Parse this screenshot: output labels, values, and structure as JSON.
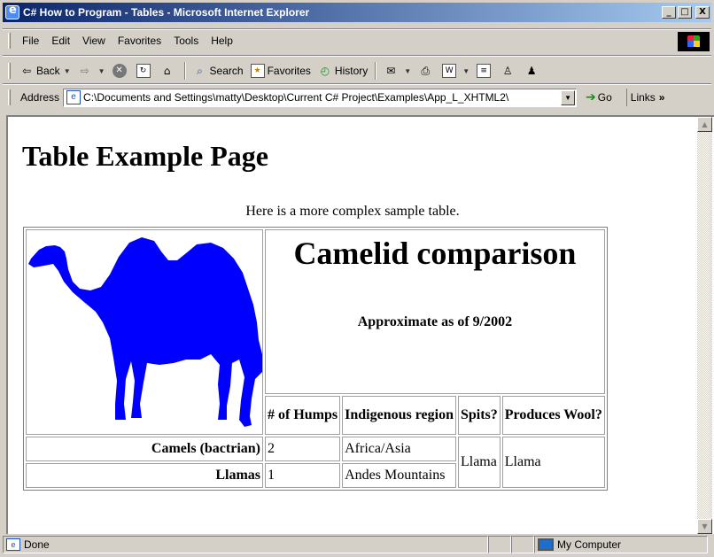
{
  "window": {
    "title": "C# How to Program - Tables - Microsoft Internet Explorer",
    "minimize": "_",
    "maximize": "□",
    "close": "X"
  },
  "menu": [
    "File",
    "Edit",
    "View",
    "Favorites",
    "Tools",
    "Help"
  ],
  "toolbar": {
    "back": "Back",
    "search": "Search",
    "favorites": "Favorites",
    "history": "History"
  },
  "address": {
    "label": "Address",
    "value": "C:\\Documents and Settings\\matty\\Desktop\\Current C# Project\\Examples\\App_L_XHTML2\\",
    "go": "Go",
    "links": "Links"
  },
  "page": {
    "heading": "Table Example Page",
    "caption": "Here is a more complex sample table.",
    "table": {
      "title": "Camelid comparison",
      "subtitle": "Approximate as of 9/2002",
      "headers": [
        "# of Humps",
        "Indigenous region",
        "Spits?",
        "Produces Wool?"
      ],
      "rows": [
        {
          "name": "Camels (bactrian)",
          "humps": "2",
          "region": "Africa/Asia"
        },
        {
          "name": "Llamas",
          "humps": "1",
          "region": "Andes Mountains"
        }
      ],
      "spits": "Llama",
      "wool": "Llama"
    }
  },
  "status": {
    "text": "Done",
    "zone": "My Computer"
  },
  "colors": {
    "camel": "#0000ff",
    "titlebar_start": "#0a246a",
    "titlebar_end": "#a6caf0"
  },
  "icons": {
    "ie": "internet-explorer-icon",
    "back": "back-arrow-icon",
    "forward": "forward-arrow-icon",
    "stop": "stop-icon",
    "refresh": "refresh-icon",
    "home": "home-icon",
    "search": "search-icon",
    "favorites": "favorites-icon",
    "history": "history-icon",
    "mail": "mail-icon",
    "print": "print-icon",
    "edit": "edit-icon",
    "discuss": "discuss-icon",
    "messenger": "messenger-icon",
    "go": "go-arrow-icon",
    "camel": "camel-image"
  }
}
